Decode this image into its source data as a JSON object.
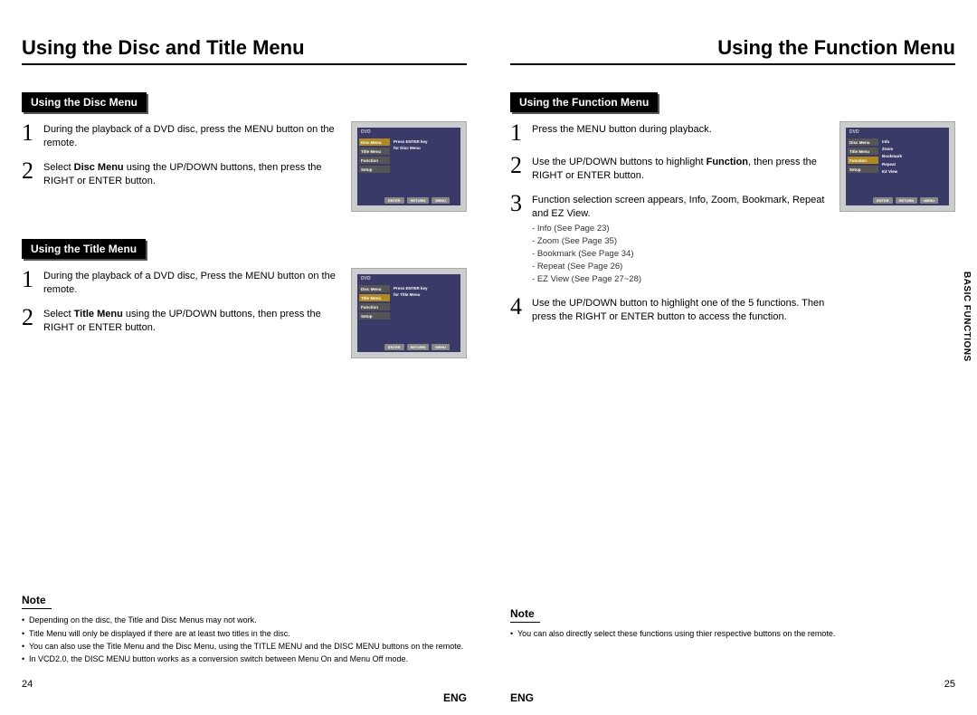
{
  "left": {
    "title": "Using the Disc and Title Menu",
    "sections": {
      "disc": {
        "label": "Using the Disc Menu",
        "steps": [
          {
            "num": "1",
            "text": "During the playback of a DVD disc, press the MENU button on the remote."
          },
          {
            "num": "2",
            "pre": "Select ",
            "bold": "Disc Menu",
            "post": " using the UP/DOWN buttons, then press the RIGHT or ENTER button."
          }
        ],
        "thumb": {
          "dvd": "DVD",
          "items": [
            "Disc Menu",
            "Title Menu",
            "Function",
            "Setup"
          ],
          "highlight": 0,
          "msg1": "Press ENTER key",
          "msg2": "for Disc Menu",
          "btns": [
            "ENTER",
            "RETURN",
            "MENU"
          ]
        }
      },
      "title": {
        "label": "Using the Title Menu",
        "steps": [
          {
            "num": "1",
            "text": "During the playback of a DVD disc, Press the MENU button on the remote."
          },
          {
            "num": "2",
            "pre": "Select ",
            "bold": "Title Menu",
            "post": " using the UP/DOWN buttons, then press the RIGHT or ENTER button."
          }
        ],
        "thumb": {
          "dvd": "DVD",
          "items": [
            "Disc Menu",
            "Title Menu",
            "Function",
            "Setup"
          ],
          "highlight": 1,
          "msg1": "Press ENTER key",
          "msg2": "for Title Menu",
          "btns": [
            "ENTER",
            "RETURN",
            "MENU"
          ]
        }
      }
    },
    "note": {
      "label": "Note",
      "items": [
        "Depending on the disc, the Title and Disc Menus may not work.",
        "Title Menu will only be displayed if there are at least two titles in the disc.",
        "You can also use the Title Menu and the Disc Menu, using the TITLE MENU and the DISC MENU buttons on the remote.",
        "In VCD2.0, the DISC MENU button works as a conversion switch between Menu On and Menu Off mode."
      ]
    },
    "page_num": "24",
    "lang": "ENG"
  },
  "right": {
    "title": "Using the Function Menu",
    "side_tab": "BASIC FUNCTIONS",
    "section": {
      "label": "Using the Function Menu",
      "steps": [
        {
          "num": "1",
          "text": "Press the MENU button during playback."
        },
        {
          "num": "2",
          "pre": "Use the UP/DOWN buttons to highlight ",
          "bold": "Function",
          "post": ", then press the RIGHT or ENTER button."
        },
        {
          "num": "3",
          "text": "Function selection screen appears, Info, Zoom, Bookmark, Repeat and EZ View.",
          "sub": [
            "Info (See Page 23)",
            "Zoom (See Page 35)",
            "Bookmark (See Page 34)",
            "Repeat (See Page 26)",
            "EZ View (See Page 27~28)"
          ]
        },
        {
          "num": "4",
          "text": "Use the UP/DOWN button to highlight one of the 5 functions. Then press the RIGHT or ENTER button to access the function."
        }
      ],
      "thumb": {
        "dvd": "DVD",
        "items": [
          "Disc Menu",
          "Title Menu",
          "Function",
          "Setup"
        ],
        "highlight": 2,
        "list": [
          "Info",
          "Zoom",
          "Bookmark",
          "Repeat",
          "EZ View"
        ],
        "btns": [
          "ENTER",
          "RETURN",
          "MENU"
        ]
      }
    },
    "note": {
      "label": "Note",
      "items": [
        "You can also directly select these functions using thier respective buttons on the remote."
      ]
    },
    "page_num": "25",
    "lang": "ENG"
  }
}
